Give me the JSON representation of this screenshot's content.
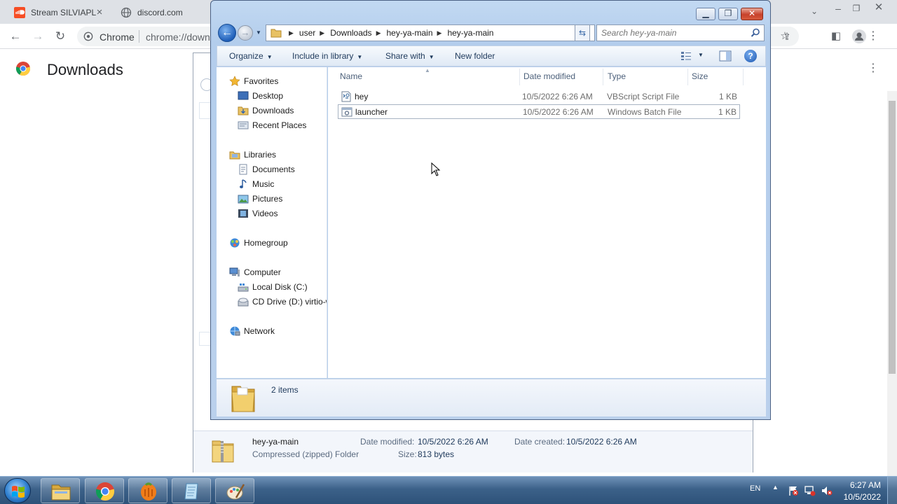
{
  "browser": {
    "tabs": [
      {
        "title": "Stream SILVIAPL",
        "favicon": "soundcloud-icon",
        "color": "#f64d24"
      },
      {
        "title": "discord.com",
        "favicon": "globe-icon"
      }
    ],
    "omnibox": {
      "chip": "Chrome",
      "url": "chrome://down"
    },
    "page_title": "Downloads"
  },
  "explorer": {
    "breadcrumb": [
      "user",
      "Downloads",
      "hey-ya-main",
      "hey-ya-main"
    ],
    "search_placeholder": "Search hey-ya-main",
    "commands": {
      "organize": "Organize",
      "include_in_library": "Include in library",
      "share_with": "Share with",
      "new_folder": "New folder"
    },
    "nav": {
      "favorites": "Favorites",
      "desktop": "Desktop",
      "downloads": "Downloads",
      "recent_places": "Recent Places",
      "libraries": "Libraries",
      "documents": "Documents",
      "music": "Music",
      "pictures": "Pictures",
      "videos": "Videos",
      "homegroup": "Homegroup",
      "computer": "Computer",
      "local_disk": "Local Disk (C:)",
      "cd_drive": "CD Drive (D:) virtio-w",
      "network": "Network"
    },
    "columns": {
      "name": "Name",
      "date_modified": "Date modified",
      "type": "Type",
      "size": "Size"
    },
    "files": [
      {
        "name": "hey",
        "date": "10/5/2022 6:26 AM",
        "type": "VBScript Script File",
        "size": "1 KB",
        "icon": "vbscript-file-icon"
      },
      {
        "name": "launcher",
        "date": "10/5/2022 6:26 AM",
        "type": "Windows Batch File",
        "size": "1 KB",
        "icon": "batch-file-icon"
      }
    ],
    "item_count": "2 items"
  },
  "background_details": {
    "name": "hey-ya-main",
    "kind": "Compressed (zipped) Folder",
    "date_modified_label": "Date modified:",
    "date_modified": "10/5/2022 6:26 AM",
    "date_created_label": "Date created:",
    "date_created": "10/5/2022 6:26 AM",
    "size_label": "Size:",
    "size": "813 bytes"
  },
  "taskbar": {
    "apps": [
      "explorer-icon",
      "chrome-icon",
      "fl-studio-icon",
      "notepad-icon",
      "paint-icon"
    ],
    "language": "EN",
    "time": "6:27 AM",
    "date": "10/5/2022"
  }
}
